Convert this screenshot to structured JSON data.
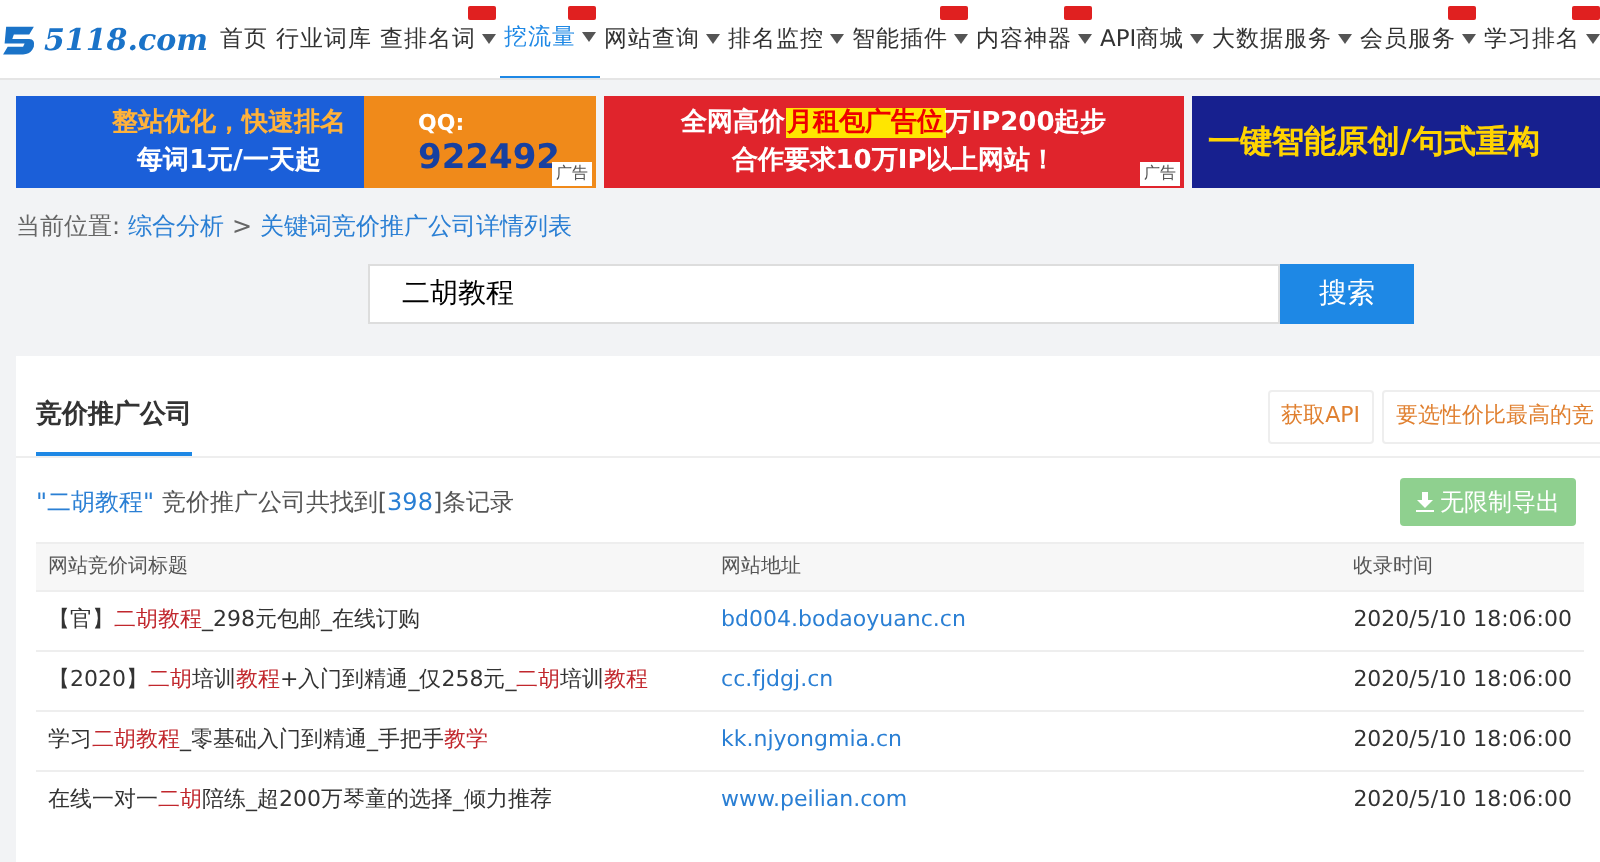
{
  "header": {
    "logo": "5118.com",
    "nav": [
      {
        "label": "首页",
        "selected": false,
        "dropdown": false,
        "tag": false
      },
      {
        "label": "行业词库",
        "selected": false,
        "dropdown": false,
        "tag": false
      },
      {
        "label": "查排名词",
        "selected": false,
        "dropdown": true,
        "tag": true
      },
      {
        "label": "挖流量",
        "selected": true,
        "dropdown": true,
        "tag": true
      },
      {
        "label": "网站查询",
        "selected": false,
        "dropdown": true,
        "tag": false
      },
      {
        "label": "排名监控",
        "selected": false,
        "dropdown": true,
        "tag": false
      },
      {
        "label": "智能插件",
        "selected": false,
        "dropdown": true,
        "tag": true
      },
      {
        "label": "内容神器",
        "selected": false,
        "dropdown": true,
        "tag": true
      },
      {
        "label": "API商城",
        "selected": false,
        "dropdown": true,
        "tag": false
      },
      {
        "label": "大数据服务",
        "selected": false,
        "dropdown": true,
        "tag": false
      },
      {
        "label": "会员服务",
        "selected": false,
        "dropdown": true,
        "tag": true
      },
      {
        "label": "学习排名",
        "selected": false,
        "dropdown": true,
        "tag": true
      }
    ]
  },
  "banners": [
    {
      "kind": "orange",
      "lines": [
        "整站优化，快速排名",
        "每词1元/一天起"
      ],
      "contact_label": "QQ:",
      "contact": "922492",
      "ad_label": "广告"
    },
    {
      "kind": "red",
      "line1": [
        {
          "text": "全网高价",
          "highlight": false
        },
        {
          "text": "月租包广告位",
          "highlight": true
        },
        {
          "text": "万IP200起步",
          "highlight": false
        }
      ],
      "line2": "合作要求10万IP以上网站！",
      "ad_label": "广告"
    },
    {
      "kind": "blue",
      "lines": [
        "一键智能原创/句式重构"
      ]
    }
  ],
  "breadcrumb": {
    "label": "当前位置:",
    "links": [
      "综合分析",
      "关键词竞价推广公司详情列表"
    ],
    "separator": ">"
  },
  "search": {
    "value": "二胡教程",
    "button": "搜索"
  },
  "card": {
    "tabs": [
      {
        "label": "竞价推广公司",
        "selected": true
      }
    ],
    "buttons": [
      "获取API",
      "要选性价比最高的竞"
    ],
    "summary": {
      "keyword": "\"二胡教程\"",
      "middle": " 竞价推广公司共找到[",
      "count": "398",
      "end": "]条记录"
    },
    "export_button": "无限制导出",
    "table": {
      "columns": [
        "网站竞价词标题",
        "网站地址",
        "收录时间"
      ],
      "rows": [
        {
          "title": [
            {
              "text": "【官】",
              "highlight": false
            },
            {
              "text": "二胡教程",
              "highlight": true
            },
            {
              "text": "_298元包邮_在线订购",
              "highlight": false
            }
          ],
          "url": "bd004.bodaoyuanc.cn",
          "time": "2020/5/10 18:06:00"
        },
        {
          "title": [
            {
              "text": "【2020】",
              "highlight": false
            },
            {
              "text": "二胡",
              "highlight": true
            },
            {
              "text": "培训",
              "highlight": false
            },
            {
              "text": "教程",
              "highlight": true
            },
            {
              "text": "+入门到精通_仅258元_",
              "highlight": false
            },
            {
              "text": "二胡",
              "highlight": true
            },
            {
              "text": "培训",
              "highlight": false
            },
            {
              "text": "教程",
              "highlight": true
            }
          ],
          "url": "cc.fjdgj.cn",
          "time": "2020/5/10 18:06:00"
        },
        {
          "title": [
            {
              "text": "学习",
              "highlight": false
            },
            {
              "text": "二胡教程",
              "highlight": true
            },
            {
              "text": "_零基础入门到精通_手把手",
              "highlight": false
            },
            {
              "text": "教学",
              "highlight": true
            }
          ],
          "url": "kk.njyongmia.cn",
          "time": "2020/5/10 18:06:00"
        },
        {
          "title": [
            {
              "text": "在线一对一",
              "highlight": false
            },
            {
              "text": "二胡",
              "highlight": true
            },
            {
              "text": "陪练_超200万琴童的选择_倾力推荐",
              "highlight": false
            }
          ],
          "url": "www.peilian.com",
          "time": "2020/5/10 18:06:00"
        }
      ]
    }
  }
}
